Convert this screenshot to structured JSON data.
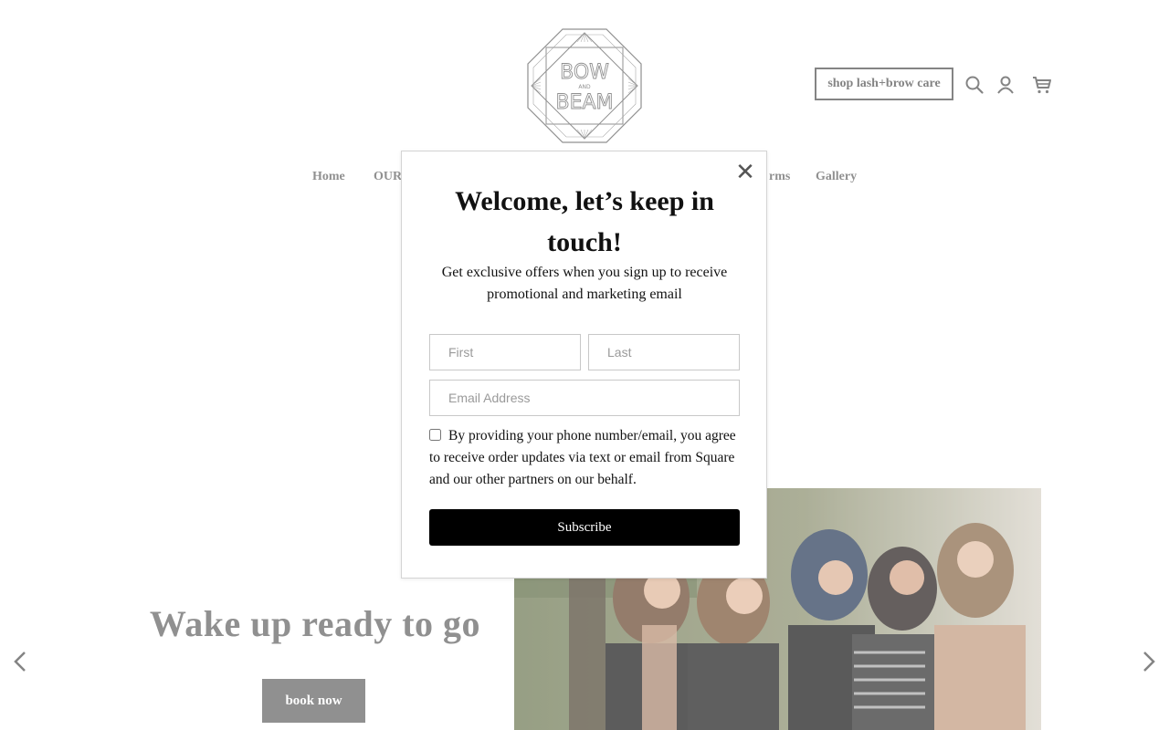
{
  "brand": {
    "logo_lines": [
      "BOW",
      "AND",
      "BEAM"
    ]
  },
  "header": {
    "shop_label": "shop lash+brow care",
    "icons": [
      "search-icon",
      "account-icon",
      "cart-icon"
    ]
  },
  "nav": {
    "home": "Home",
    "our_partial": "OUR",
    "forms_partial": "rms",
    "gallery": "Gallery"
  },
  "hero": {
    "title": "Wake up ready to go",
    "book_label": "book now",
    "image": "group-photo"
  },
  "popup": {
    "title": "Welcome, let’s keep in touch!",
    "subtitle": "Get exclusive offers when you sign up to receive promotional and marketing email",
    "first_placeholder": "First",
    "last_placeholder": "Last",
    "email_placeholder": "Email Address",
    "consent": "By providing your phone number/email, you agree to receive order updates via text or email from Square and our other partners on our behalf.",
    "subscribe_label": "Subscribe",
    "close_symbol": "✕"
  },
  "colors": {
    "accent": "#000000",
    "muted_text": "#666666"
  }
}
